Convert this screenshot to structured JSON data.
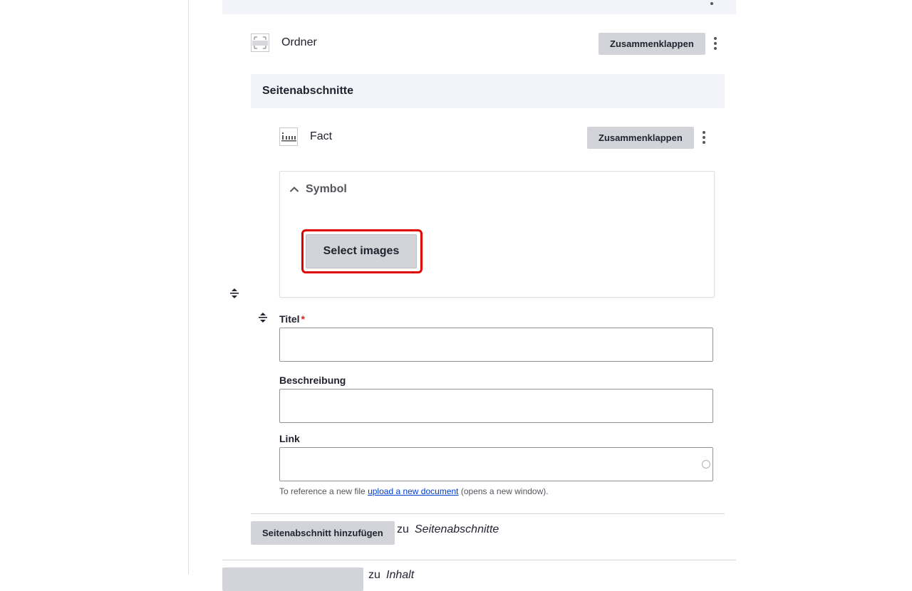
{
  "outer_paragraph": {
    "kebab_icon": "vertical-ellipsis"
  },
  "folder": {
    "label": "Ordner",
    "icon": "folder-paragraph-icon",
    "collapse_label": "Zusammenklappen"
  },
  "sections": {
    "header": "Seitenabschnitte"
  },
  "fact": {
    "label": "Fact",
    "icon": "fact-paragraph-icon",
    "collapse_label": "Zusammenklappen",
    "symbol": {
      "summary": "Symbol",
      "expanded": true,
      "select_label": "Select images"
    },
    "fields": {
      "title_label": "Titel",
      "required_marker": "*",
      "title_value": "",
      "description_label": "Beschreibung",
      "description_value": "",
      "link_label": "Link",
      "link_value": "",
      "help_prefix": "To reference a new file",
      "help_link": "upload a new document",
      "help_suffix": "(opens a new window)."
    }
  },
  "add_section": {
    "button_label": "Seitenabschnitt hinzufügen",
    "zu": "zu",
    "target": "Seitenabschnitte"
  },
  "add_content": {
    "zu": "zu",
    "target": "Inhalt"
  },
  "colors": {
    "focus_ring": "#e00000",
    "button_bg": "#d3d4d9",
    "header_bg": "#f3f4f9",
    "link": "#003ecc",
    "required": "#dc2323"
  }
}
